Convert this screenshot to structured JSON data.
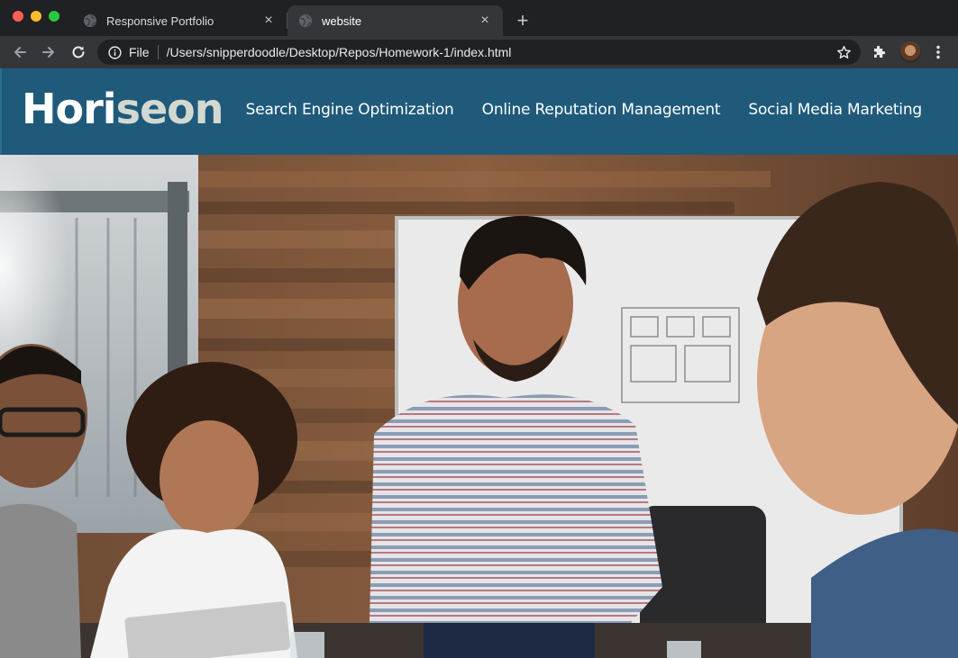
{
  "browser": {
    "tabs": [
      {
        "title": "Responsive Portfolio",
        "active": false
      },
      {
        "title": "website",
        "active": true
      }
    ],
    "new_tab_label": "+",
    "close_glyph": "×",
    "address": {
      "scheme_label": "File",
      "url": "/Users/snipperdoodle/Desktop/Repos/Homework-1/index.html"
    },
    "icons": [
      "back-arrow-icon",
      "forward-arrow-icon",
      "reload-icon",
      "info-icon",
      "star-icon",
      "puzzle-extension-icon",
      "profile-avatar",
      "kebab-menu-icon"
    ]
  },
  "site": {
    "logo_part1": "Hori",
    "logo_part2": "seon",
    "nav": [
      "Search Engine Optimization",
      "Online Reputation Management",
      "Social Media Marketing"
    ],
    "colors": {
      "header_bg": "#1f5a7b",
      "logo_primary": "#ffffff",
      "logo_secondary": "#d3d9d0"
    },
    "hero_image": "team-meeting-photo"
  }
}
